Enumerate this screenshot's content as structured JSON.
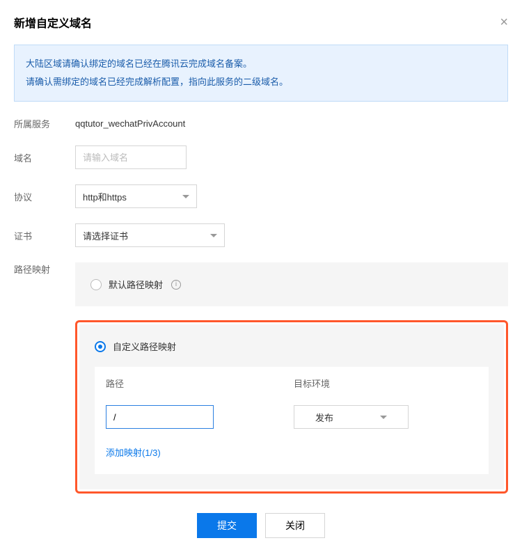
{
  "dialog": {
    "title": "新增自定义域名",
    "notice_line1": "大陆区域请确认绑定的域名已经在腾讯云完成域名备案。",
    "notice_line2": "请确认需绑定的域名已经完成解析配置，指向此服务的二级域名。"
  },
  "fields": {
    "service_label": "所属服务",
    "service_value": "qqtutor_wechatPrivAccount",
    "domain_label": "域名",
    "domain_placeholder": "请输入域名",
    "protocol_label": "协议",
    "protocol_value": "http和https",
    "cert_label": "证书",
    "cert_placeholder": "请选择证书",
    "path_map_label": "路径映射"
  },
  "mapping": {
    "default_label": "默认路径映射",
    "custom_label": "自定义路径映射",
    "col_path": "路径",
    "col_env": "目标环境",
    "path_value": "/",
    "env_value": "发布",
    "add_link": "添加映射(1/3)"
  },
  "footer": {
    "submit": "提交",
    "close": "关闭"
  }
}
